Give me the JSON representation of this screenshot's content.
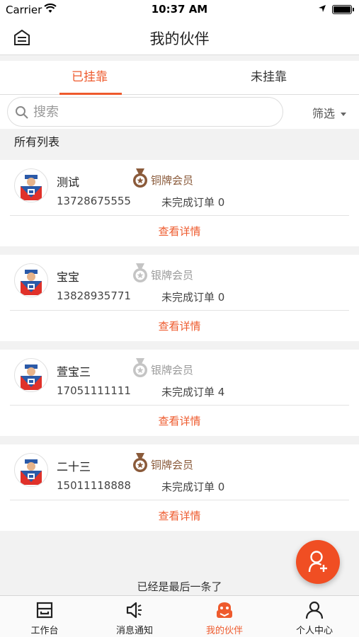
{
  "status_bar": {
    "carrier": "Carrier",
    "time": "10:37 AM"
  },
  "nav": {
    "title": "我的伙伴"
  },
  "tabs": [
    {
      "label": "已挂靠",
      "active": true
    },
    {
      "label": "未挂靠",
      "active": false
    }
  ],
  "search": {
    "placeholder": "搜索",
    "filter_label": "筛选"
  },
  "list_title": "所有列表",
  "partners": [
    {
      "name": "测试",
      "phone": "13728675555",
      "level": "铜牌会员",
      "orders": "未完成订单 0",
      "detail": "查看详情"
    },
    {
      "name": "宝宝",
      "phone": "13828935771",
      "level": "银牌会员",
      "orders": "未完成订单 0",
      "detail": "查看详情"
    },
    {
      "name": "萱宝三",
      "phone": "17051111111",
      "level": "银牌会员",
      "orders": "未完成订单 4",
      "detail": "查看详情"
    },
    {
      "name": "二十三",
      "phone": "15011118888",
      "level": "铜牌会员",
      "orders": "未完成订单 0",
      "detail": "查看详情"
    }
  ],
  "end_text": "已经是最后一条了",
  "tabbar": [
    {
      "label": "工作台",
      "icon": "workbench-icon"
    },
    {
      "label": "消息通知",
      "icon": "megaphone-icon"
    },
    {
      "label": "我的伙伴",
      "icon": "partner-icon",
      "active": true
    },
    {
      "label": "个人中心",
      "icon": "person-icon"
    }
  ],
  "colors": {
    "accent": "#ee5a2d",
    "copper": "#8a5a3a",
    "silver": "#b0b0b0"
  }
}
